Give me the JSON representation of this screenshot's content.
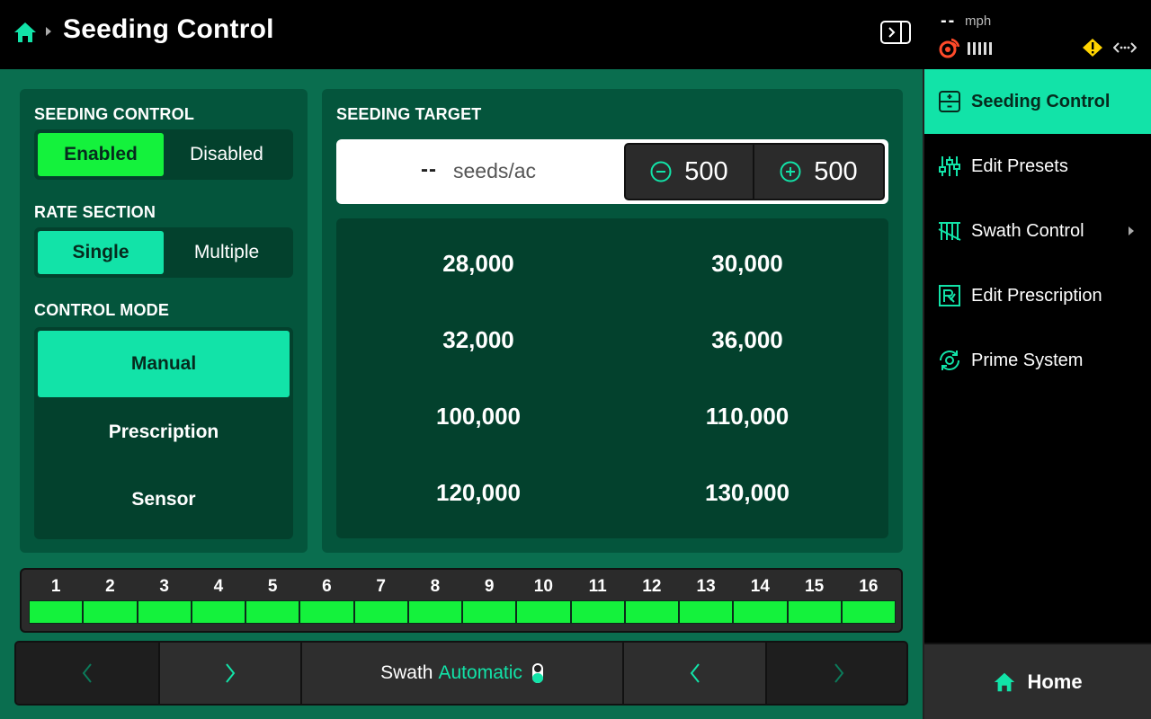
{
  "header": {
    "title": "Seeding Control"
  },
  "status": {
    "speed_value": "--",
    "speed_unit": "mph"
  },
  "seeding_control": {
    "label": "SEEDING CONTROL",
    "options": [
      "Enabled",
      "Disabled"
    ],
    "selected": "Enabled"
  },
  "rate_section": {
    "label": "RATE SECTION",
    "options": [
      "Single",
      "Multiple"
    ],
    "selected": "Single"
  },
  "control_mode": {
    "label": "CONTROL MODE",
    "options": [
      "Manual",
      "Prescription",
      "Sensor"
    ],
    "selected": "Manual"
  },
  "seeding_target": {
    "label": "SEEDING TARGET",
    "value": "--",
    "unit": "seeds/ac",
    "decrement": "500",
    "increment": "500",
    "presets": [
      "28,000",
      "30,000",
      "32,000",
      "36,000",
      "100,000",
      "110,000",
      "120,000",
      "130,000"
    ]
  },
  "sections": {
    "numbers": [
      "1",
      "2",
      "3",
      "4",
      "5",
      "6",
      "7",
      "8",
      "9",
      "10",
      "11",
      "12",
      "13",
      "14",
      "15",
      "16"
    ],
    "active_color": "#14f23c"
  },
  "bottom_bar": {
    "swath_label": "Swath",
    "swath_mode": "Automatic"
  },
  "sidebar": {
    "items": [
      {
        "label": "Seeding Control",
        "icon": "seeding-control-icon",
        "active": true
      },
      {
        "label": "Edit Presets",
        "icon": "sliders-icon",
        "active": false
      },
      {
        "label": "Swath Control",
        "icon": "swath-icon",
        "active": false
      },
      {
        "label": "Edit Prescription",
        "icon": "prescription-icon",
        "active": false
      },
      {
        "label": "Prime System",
        "icon": "prime-icon",
        "active": false
      }
    ],
    "home_label": "Home"
  },
  "colors": {
    "accent": "#12e3a8",
    "enabled_green": "#14f23c",
    "background": "#0a6e4f",
    "card": "#04553c",
    "warning": "#ffd400",
    "alert": "#ff4a2a"
  }
}
